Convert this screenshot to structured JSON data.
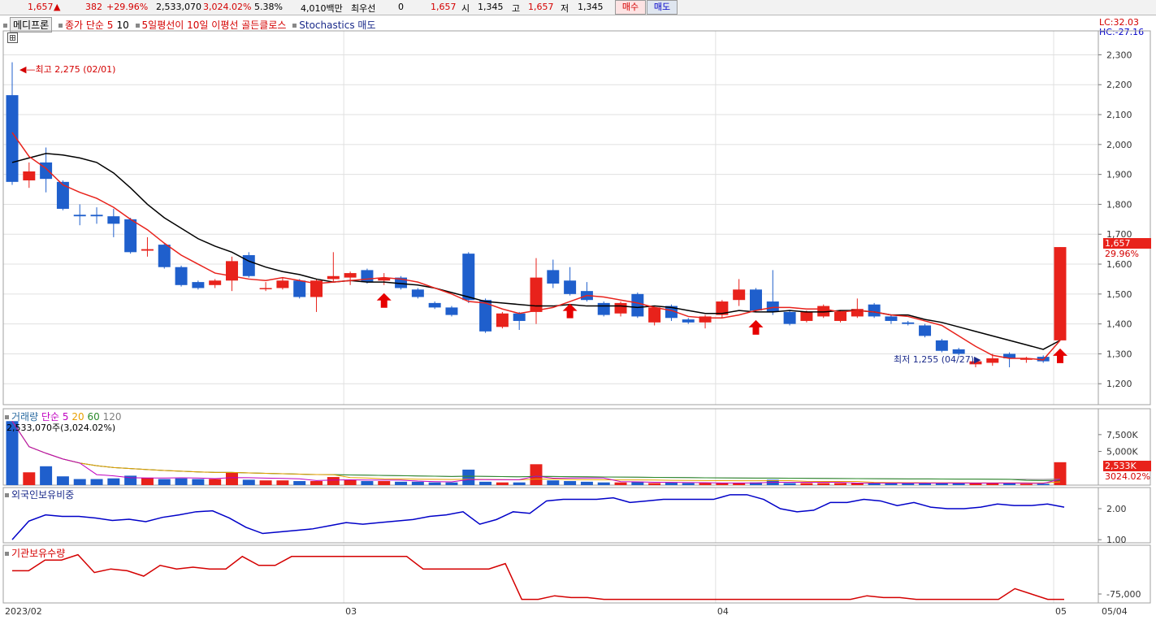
{
  "topbar": {
    "price": "1,657",
    "change": "382",
    "change_pct": "+29.96%",
    "volume": "2,533,070",
    "volume_pct": "3,024.02%",
    "turnover_pct": "5.38%",
    "amount": "4,010백만",
    "best_ask_label": "최우선",
    "best_ask_qty": "0",
    "best_ask_price": "1,657",
    "open_label": "시",
    "open": "1,345",
    "high_label": "고",
    "high": "1,657",
    "low_label": "저",
    "low": "1,345",
    "buy_label": "매수",
    "sell_label": "매도"
  },
  "legend": {
    "tab": "메디프론",
    "ma_label": "종가 단순 5",
    "ma2": "10",
    "signal1": "5일평선이 10일 이평선 골든클로스",
    "signal2": "Stochastics 매도"
  },
  "right_info": {
    "lc": "LC:32.03",
    "hc": "HC:-27.16",
    "last_price": "1,657",
    "last_pct": "29.96%",
    "vol_last": "2,533K",
    "vol_pct": "3024.02%"
  },
  "annotations": {
    "high": "최고 2,275 (02/01)",
    "low": "최저 1,255 (04/27)"
  },
  "volume_panel": {
    "title": "거래량",
    "ma_label": "단순",
    "ma_periods": [
      "5",
      "20",
      "60",
      "120"
    ],
    "value_text": "2,533,070주(3,024.02%)"
  },
  "foreign_panel": {
    "title": "외국인보유비중"
  },
  "inst_panel": {
    "title": "기관보유수량"
  },
  "colors": {
    "up": "#e8221b",
    "down": "#1f5fcc",
    "ma5": "#e8221b",
    "ma10": "#000000",
    "foreign": "#0000c8",
    "inst": "#d40000",
    "vol_ma5": "#c000c0",
    "vol_ma20": "#e8a000",
    "vol_ma60": "#2a8a2a",
    "vol_ma120": "#808080"
  },
  "chart_data": [
    {
      "type": "candlestick",
      "title": "메디프론",
      "x_ticks": [
        "2023/02",
        "03",
        "04",
        "05",
        "05/04"
      ],
      "y_ticks": [
        "2,300",
        "2,200",
        "2,100",
        "2,000",
        "1,900",
        "1,800",
        "1,700",
        "1,600",
        "1,500",
        "1,400",
        "1,300",
        "1,200"
      ],
      "ylim": [
        1130,
        2380
      ],
      "candles": [
        {
          "o": 2165,
          "h": 2275,
          "l": 1865,
          "c": 1875
        },
        {
          "o": 1880,
          "h": 1940,
          "l": 1855,
          "c": 1910
        },
        {
          "o": 1940,
          "h": 1990,
          "l": 1840,
          "c": 1885
        },
        {
          "o": 1875,
          "h": 1880,
          "l": 1780,
          "c": 1785
        },
        {
          "o": 1765,
          "h": 1800,
          "l": 1730,
          "c": 1760
        },
        {
          "o": 1765,
          "h": 1790,
          "l": 1735,
          "c": 1760
        },
        {
          "o": 1760,
          "h": 1785,
          "l": 1690,
          "c": 1735
        },
        {
          "o": 1750,
          "h": 1755,
          "l": 1635,
          "c": 1640
        },
        {
          "o": 1645,
          "h": 1690,
          "l": 1625,
          "c": 1650
        },
        {
          "o": 1665,
          "h": 1670,
          "l": 1585,
          "c": 1590
        },
        {
          "o": 1590,
          "h": 1595,
          "l": 1525,
          "c": 1530
        },
        {
          "o": 1540,
          "h": 1545,
          "l": 1515,
          "c": 1520
        },
        {
          "o": 1530,
          "h": 1550,
          "l": 1520,
          "c": 1545
        },
        {
          "o": 1545,
          "h": 1625,
          "l": 1510,
          "c": 1610
        },
        {
          "o": 1630,
          "h": 1640,
          "l": 1555,
          "c": 1560
        },
        {
          "o": 1520,
          "h": 1540,
          "l": 1510,
          "c": 1520
        },
        {
          "o": 1520,
          "h": 1555,
          "l": 1515,
          "c": 1545
        },
        {
          "o": 1545,
          "h": 1550,
          "l": 1485,
          "c": 1490
        },
        {
          "o": 1490,
          "h": 1550,
          "l": 1440,
          "c": 1545
        },
        {
          "o": 1550,
          "h": 1640,
          "l": 1540,
          "c": 1560
        },
        {
          "o": 1555,
          "h": 1575,
          "l": 1530,
          "c": 1570
        },
        {
          "o": 1580,
          "h": 1585,
          "l": 1535,
          "c": 1540
        },
        {
          "o": 1545,
          "h": 1570,
          "l": 1530,
          "c": 1555
        },
        {
          "o": 1555,
          "h": 1560,
          "l": 1515,
          "c": 1520
        },
        {
          "o": 1515,
          "h": 1520,
          "l": 1485,
          "c": 1490
        },
        {
          "o": 1470,
          "h": 1475,
          "l": 1450,
          "c": 1455
        },
        {
          "o": 1455,
          "h": 1460,
          "l": 1425,
          "c": 1430
        },
        {
          "o": 1635,
          "h": 1640,
          "l": 1470,
          "c": 1480
        },
        {
          "o": 1480,
          "h": 1485,
          "l": 1370,
          "c": 1375
        },
        {
          "o": 1390,
          "h": 1440,
          "l": 1385,
          "c": 1435
        },
        {
          "o": 1435,
          "h": 1440,
          "l": 1380,
          "c": 1410
        },
        {
          "o": 1440,
          "h": 1620,
          "l": 1400,
          "c": 1555
        },
        {
          "o": 1580,
          "h": 1615,
          "l": 1520,
          "c": 1535
        },
        {
          "o": 1545,
          "h": 1590,
          "l": 1495,
          "c": 1500
        },
        {
          "o": 1510,
          "h": 1540,
          "l": 1475,
          "c": 1480
        },
        {
          "o": 1470,
          "h": 1475,
          "l": 1425,
          "c": 1430
        },
        {
          "o": 1435,
          "h": 1475,
          "l": 1425,
          "c": 1470
        },
        {
          "o": 1500,
          "h": 1505,
          "l": 1420,
          "c": 1425
        },
        {
          "o": 1405,
          "h": 1455,
          "l": 1395,
          "c": 1455
        },
        {
          "o": 1460,
          "h": 1465,
          "l": 1410,
          "c": 1420
        },
        {
          "o": 1415,
          "h": 1420,
          "l": 1400,
          "c": 1405
        },
        {
          "o": 1405,
          "h": 1430,
          "l": 1385,
          "c": 1425
        },
        {
          "o": 1430,
          "h": 1480,
          "l": 1420,
          "c": 1475
        },
        {
          "o": 1480,
          "h": 1550,
          "l": 1460,
          "c": 1515
        },
        {
          "o": 1515,
          "h": 1520,
          "l": 1440,
          "c": 1445
        },
        {
          "o": 1475,
          "h": 1580,
          "l": 1430,
          "c": 1440
        },
        {
          "o": 1440,
          "h": 1445,
          "l": 1395,
          "c": 1400
        },
        {
          "o": 1410,
          "h": 1445,
          "l": 1405,
          "c": 1440
        },
        {
          "o": 1425,
          "h": 1465,
          "l": 1420,
          "c": 1460
        },
        {
          "o": 1410,
          "h": 1445,
          "l": 1405,
          "c": 1440
        },
        {
          "o": 1425,
          "h": 1485,
          "l": 1420,
          "c": 1450
        },
        {
          "o": 1465,
          "h": 1470,
          "l": 1420,
          "c": 1425
        },
        {
          "o": 1425,
          "h": 1430,
          "l": 1400,
          "c": 1410
        },
        {
          "o": 1405,
          "h": 1410,
          "l": 1395,
          "c": 1400
        },
        {
          "o": 1395,
          "h": 1400,
          "l": 1355,
          "c": 1360
        },
        {
          "o": 1345,
          "h": 1350,
          "l": 1305,
          "c": 1310
        },
        {
          "o": 1315,
          "h": 1320,
          "l": 1295,
          "c": 1300
        },
        {
          "o": 1265,
          "h": 1285,
          "l": 1255,
          "c": 1275
        },
        {
          "o": 1270,
          "h": 1300,
          "l": 1260,
          "c": 1285
        },
        {
          "o": 1300,
          "h": 1305,
          "l": 1255,
          "c": 1285
        },
        {
          "o": 1280,
          "h": 1290,
          "l": 1270,
          "c": 1285
        },
        {
          "o": 1290,
          "h": 1295,
          "l": 1270,
          "c": 1275
        },
        {
          "o": 1345,
          "h": 1657,
          "l": 1345,
          "c": 1657
        }
      ],
      "ma5": [
        2040,
        1960,
        1920,
        1865,
        1840,
        1820,
        1790,
        1750,
        1715,
        1670,
        1630,
        1600,
        1570,
        1560,
        1550,
        1545,
        1555,
        1545,
        1535,
        1540,
        1545,
        1550,
        1555,
        1550,
        1540,
        1520,
        1500,
        1475,
        1470,
        1450,
        1435,
        1445,
        1455,
        1475,
        1495,
        1490,
        1480,
        1470,
        1455,
        1445,
        1425,
        1420,
        1420,
        1430,
        1445,
        1455,
        1455,
        1450,
        1450,
        1440,
        1445,
        1440,
        1430,
        1425,
        1410,
        1395,
        1360,
        1325,
        1295,
        1285,
        1285,
        1280,
        1345
      ],
      "ma10": [
        1940,
        1955,
        1970,
        1965,
        1955,
        1940,
        1905,
        1855,
        1800,
        1755,
        1720,
        1685,
        1660,
        1640,
        1610,
        1590,
        1575,
        1565,
        1550,
        1540,
        1545,
        1540,
        1540,
        1535,
        1530,
        1520,
        1505,
        1490,
        1475,
        1470,
        1465,
        1460,
        1460,
        1465,
        1460,
        1460,
        1460,
        1455,
        1460,
        1455,
        1445,
        1435,
        1435,
        1445,
        1440,
        1440,
        1445,
        1440,
        1440,
        1445,
        1445,
        1440,
        1430,
        1430,
        1415,
        1405,
        1390,
        1375,
        1360,
        1345,
        1330,
        1315,
        1345
      ],
      "up_arrows": [
        22,
        33,
        44,
        63
      ],
      "volume": [
        9500,
        1900,
        2800,
        1300,
        900,
        900,
        1000,
        1400,
        1100,
        900,
        1000,
        900,
        900,
        1900,
        800,
        700,
        700,
        600,
        600,
        1200,
        800,
        600,
        600,
        500,
        500,
        400,
        400,
        2300,
        500,
        400,
        400,
        3100,
        700,
        600,
        500,
        400,
        400,
        500,
        300,
        400,
        300,
        300,
        300,
        300,
        400,
        800,
        300,
        300,
        300,
        300,
        300,
        300,
        300,
        300,
        300,
        300,
        300,
        300,
        300,
        300,
        200,
        200,
        3400
      ],
      "foreign_ratio": [
        1.0,
        1.6,
        1.8,
        1.75,
        1.75,
        1.7,
        1.62,
        1.66,
        1.58,
        1.72,
        1.8,
        1.9,
        1.93,
        1.7,
        1.4,
        1.2,
        1.25,
        1.3,
        1.35,
        1.45,
        1.55,
        1.5,
        1.55,
        1.6,
        1.65,
        1.75,
        1.8,
        1.9,
        1.5,
        1.65,
        1.9,
        1.85,
        2.25,
        2.3,
        2.3,
        2.3,
        2.35,
        2.2,
        2.25,
        2.3,
        2.3,
        2.3,
        2.3,
        2.45,
        2.45,
        2.3,
        2.0,
        1.9,
        1.95,
        2.2,
        2.2,
        2.3,
        2.25,
        2.1,
        2.2,
        2.05,
        2.0,
        2.0,
        2.05,
        2.15,
        2.1,
        2.1,
        2.15,
        2.05
      ],
      "inst_qty": [
        -62,
        -62,
        -56,
        -56,
        -53,
        -63,
        -61,
        -62,
        -65,
        -59,
        -61,
        -60,
        -61,
        -61,
        -54,
        -59,
        -59,
        -54,
        -54,
        -54,
        -54,
        -54,
        -54,
        -54,
        -54,
        -61,
        -61,
        -61,
        -61,
        -61,
        -58,
        -78,
        -78,
        -76,
        -77,
        -77,
        -78,
        -78,
        -78,
        -78,
        -78,
        -78,
        -78,
        -78,
        -78,
        -78,
        -78,
        -78,
        -78,
        -78,
        -78,
        -78,
        -76,
        -77,
        -77,
        -78,
        -78,
        -78,
        -78,
        -78,
        -78,
        -72,
        -75,
        -78,
        -78
      ]
    }
  ]
}
